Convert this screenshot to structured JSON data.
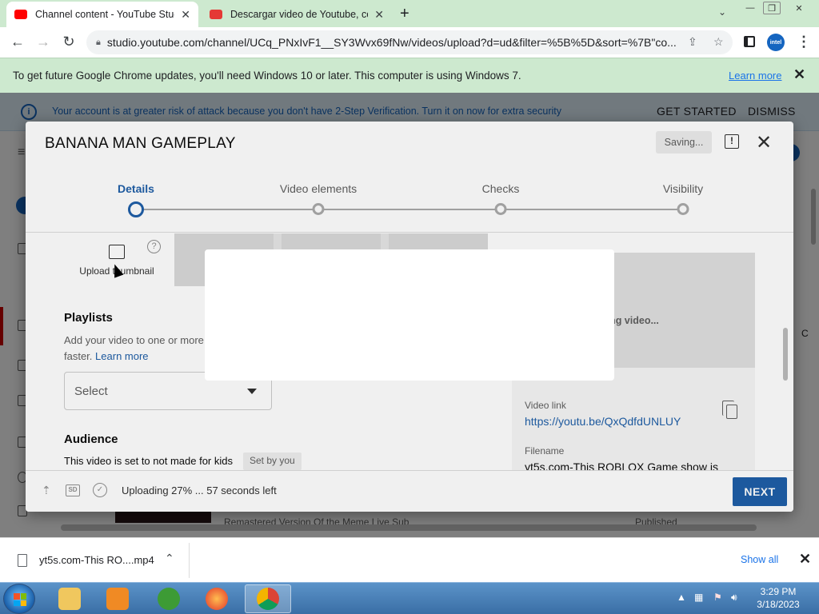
{
  "browser": {
    "tabs": [
      {
        "title": "Channel content - YouTube Studio",
        "favicon_color": "#ff0000",
        "active": true
      },
      {
        "title": "Descargar video de Youtube, con",
        "favicon_color": "#e53935",
        "active": false
      }
    ],
    "url": "studio.youtube.com/channel/UCq_PNxIvF1__SY3Wvx69fNw/videos/upload?d=ud&filter=%5B%5D&sort=%7B\"co...",
    "profile_label": "intel"
  },
  "update_bar": {
    "message": "To get future Google Chrome updates, you'll need Windows 10 or later. This computer is using Windows 7.",
    "learn_more": "Learn more"
  },
  "security_banner": {
    "text": "Your account is at greater risk of attack because you don't have 2-Step Verification. Turn it on now for extra security",
    "get_started": "GET STARTED",
    "dismiss": "DISMISS"
  },
  "background_page": {
    "row_text_left": "Remastered Version Of the Meme Live Sub",
    "row_text_right": "Published",
    "side_char": "C"
  },
  "modal": {
    "title": "BANANA MAN GAMEPLAY",
    "saving": "Saving...",
    "steps": [
      "Details",
      "Video elements",
      "Checks",
      "Visibility"
    ],
    "active_step": "Details",
    "upload_thumbnail": "Upload thumbnail",
    "playlists_heading": "Playlists",
    "playlists_desc_1": "Add your video to one or more",
    "playlists_desc_2": "faster.",
    "learn_more": "Learn more",
    "select_placeholder": "Select",
    "audience_heading": "Audience",
    "kids_text": "This video is set to not made for kids",
    "set_by_you": "Set by you",
    "preview_status": "ading video...",
    "video_link_label": "Video link",
    "video_link": "https://youtu.be/QxQdfdUNLUY",
    "filename_label": "Filename",
    "filename": "yt5s.com-This ROBLOX Game show is",
    "sd_label": "SD",
    "upload_progress": "Uploading 27% ... 57 seconds left",
    "next": "NEXT"
  },
  "downloads": {
    "file": "yt5s.com-This RO....mp4",
    "show_all": "Show all"
  },
  "taskbar": {
    "time": "3:29 PM",
    "date": "3/18/2023"
  }
}
